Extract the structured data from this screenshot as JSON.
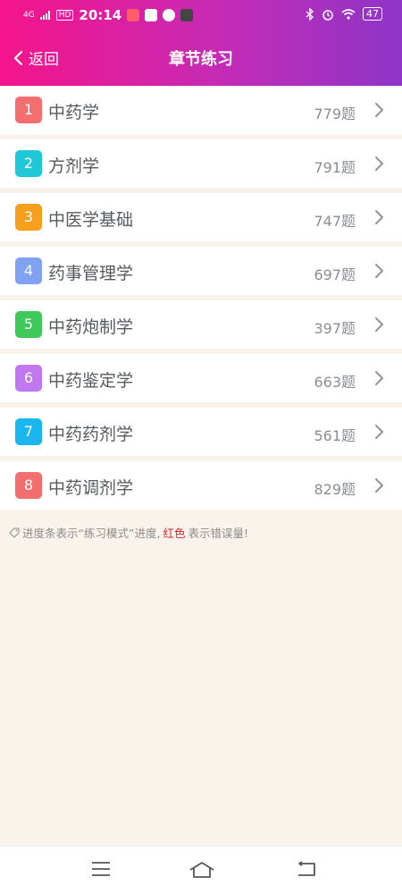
{
  "status_bar": {
    "signal": "4G",
    "hd": "HD",
    "time": "20:14",
    "battery": "47"
  },
  "nav": {
    "back_label": "返回",
    "title": "章节练习"
  },
  "chapters": [
    {
      "index": "1",
      "name": "中药学",
      "count": "779题",
      "color": "#f36e6e"
    },
    {
      "index": "2",
      "name": "方剂学",
      "count": "791题",
      "color": "#1fc8d6"
    },
    {
      "index": "3",
      "name": "中医学基础",
      "count": "747题",
      "color": "#f7a01e"
    },
    {
      "index": "4",
      "name": "药事管理学",
      "count": "697题",
      "color": "#7fa2f2"
    },
    {
      "index": "5",
      "name": "中药炮制学",
      "count": "397题",
      "color": "#3fc95a"
    },
    {
      "index": "6",
      "name": "中药鉴定学",
      "count": "663题",
      "color": "#c077ef"
    },
    {
      "index": "7",
      "name": "中药药剂学",
      "count": "561题",
      "color": "#1ab7ef"
    },
    {
      "index": "8",
      "name": "中药调剂学",
      "count": "829题",
      "color": "#f36e6e"
    }
  ],
  "tip": {
    "prefix": "进度条表示“练习模式”进度,",
    "red": "红色",
    "suffix": "表示错误量!"
  }
}
